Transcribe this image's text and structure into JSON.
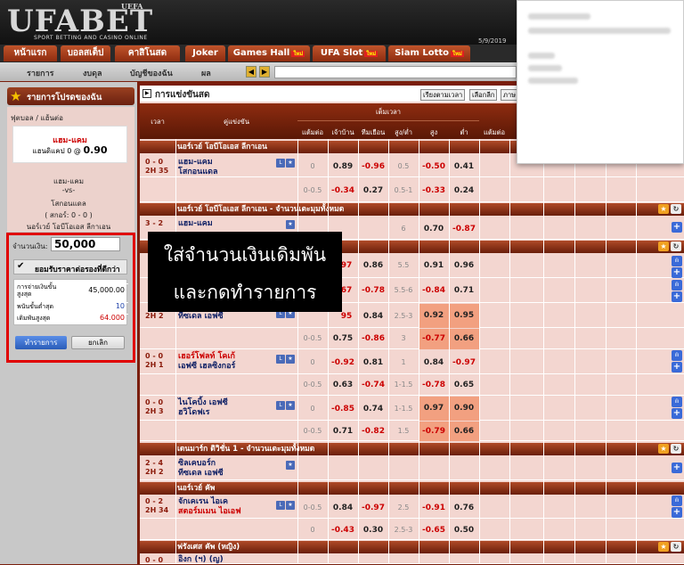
{
  "brand": {
    "logo": "UFABET",
    "uefa": "UEFA",
    "tagline": "SPORT BETTING AND CASINO ONLINE"
  },
  "nav": {
    "tabs": [
      {
        "label": "หน้าแรก"
      },
      {
        "label": "บอลสเต็ป"
      },
      {
        "label": "คาสิโนสด"
      },
      {
        "label": "Joker"
      },
      {
        "label": "Games Hall",
        "badge": "ใหม่"
      },
      {
        "label": "UFA Slot",
        "badge": "ใหม่"
      },
      {
        "label": "Siam Lotto",
        "badge": "ใหม่"
      }
    ],
    "sub": [
      "รายการ",
      "งบดุล",
      "บัญชีของฉัน",
      "ผล"
    ],
    "date": "5/9/2019"
  },
  "left": {
    "header": "รายการโปรดของฉัน",
    "sport": "ฟุตบอล / แฮ้นต่อ",
    "pick_team": "แฮม-แคม",
    "pick_line": "แฮนดิแคป 0 @",
    "pick_odds": "0.90",
    "home": "แฮม-แคม",
    "vs": "-vs-",
    "away": "โสกอนแดล",
    "score": "( สกอร์: 0 - 0 )",
    "league": "นอร์เวย์ โอบีโอเอส ลีกาเอน",
    "amount_label": "จำนวนเงิน:",
    "amount": "50,000",
    "accept_label": "ยอมรับราคาต่อรองที่ดีกว่า",
    "limits": [
      {
        "label": "การจ่ายเงินขั้นสูงสุด",
        "value": "45,000.00"
      },
      {
        "label": "พนันขั้นต่ำสุด",
        "value": "10"
      },
      {
        "label": "เดิมพันสูงสุด",
        "value": "64.000"
      }
    ],
    "submit": "ทำรายการ",
    "cancel": "ยกเลิก"
  },
  "main": {
    "title": "การแข่งขันสด",
    "sort1": "เรียงตามเวลา",
    "sort2": "เลือกลีก",
    "sort3": "ภาษ",
    "headers": {
      "time": "เวลา",
      "match": "คู่แข่งขัน",
      "fulltime": "เต็มเวลา",
      "hdp": "แต้มต่อ",
      "home": "เจ้าบ้าน",
      "away": "ทีมเยือน",
      "ou": "สูง/ต่ำ",
      "over": "สูง",
      "under": "ต่ำ",
      "extra": "แต้มต่อ"
    }
  },
  "overlay": {
    "line1": "ใส่จำนวนเงินเดิมพัน",
    "line2": "และกดทำรายการ"
  },
  "leagues": [
    {
      "name": "นอร์เวย์ โอบีโอเอส ลีกาเอน"
    },
    {
      "name": "นอร์เวย์ โอบีโอเอส ลีกาเอน - จำนวนเตะมุมทั้งหมด"
    },
    {
      "name": "เดนมาร์ก ดิวิชั่น 1 - จำนวนเตะมุมทั้งหมด"
    },
    {
      "name": "นอร์เวย์ คัพ"
    },
    {
      "name": "ฟรังเศส คัพ (หญิง)"
    }
  ],
  "matches": [
    {
      "score": "0 - 0",
      "time": "2H 35",
      "home": "แฮม-แคม",
      "away": "โสกอนแดล",
      "r1": [
        "0",
        "0.89",
        "-0.96",
        "0.5",
        "-0.50",
        "0.41"
      ],
      "r2": [
        "0-0.5",
        "-0.34",
        "0.27",
        "0.5-1",
        "-0.33",
        "0.24"
      ]
    },
    {
      "score": "3 - 2",
      "home": "แฮม-แคม",
      "r1": [
        "6",
        "0.70",
        "-0.87"
      ]
    },
    {
      "r1": [
        "97",
        "0.86",
        "5.5",
        "0.91",
        "0.96"
      ],
      "r2": [
        "67",
        "-0.78",
        "5.5-6",
        "-0.84",
        "0.71"
      ]
    },
    {
      "time": "2H 2",
      "away": "ทีซเดล เอฟซี",
      "r1": [
        "95",
        "0.84",
        "2.5-3",
        "0.92",
        "0.95"
      ],
      "r2": [
        "0-0.5",
        "0.75",
        "-0.86",
        "3",
        "-0.77",
        "0.66"
      ]
    },
    {
      "score": "0 - 0",
      "time": "2H 1",
      "home": "เฮอร์โฟลท์ โคเก้",
      "away": "เอฟซี เฮลซิงกอร์",
      "r1": [
        "0",
        "-0.92",
        "0.81",
        "1",
        "0.84",
        "-0.97"
      ],
      "r2": [
        "0-0.5",
        "0.63",
        "-0.74",
        "1-1.5",
        "-0.78",
        "0.65"
      ]
    },
    {
      "score": "0 - 0",
      "time": "2H 3",
      "home": "ไนโคบิ้ง เอฟซี",
      "away": "ฮวิโดฟเร",
      "r1": [
        "0",
        "-0.85",
        "0.74",
        "1-1.5",
        "0.97",
        "0.90"
      ],
      "r2": [
        "0-0.5",
        "0.71",
        "-0.82",
        "1.5",
        "-0.79",
        "0.66"
      ]
    },
    {
      "score": "2 - 4",
      "time": "2H 2",
      "home": "ซิลเคบอร์ก",
      "away": "ทีซเดล เอฟซี"
    },
    {
      "score": "0 - 2",
      "time": "2H 34",
      "home": "จักเคเรน ไอเค",
      "away": "สตอร์มเมน ไอเอฟ",
      "r1": [
        "0-0.5",
        "0.84",
        "-0.97",
        "2.5",
        "-0.91",
        "0.76"
      ],
      "r2": [
        "0",
        "-0.43",
        "0.30",
        "2.5-3",
        "-0.65",
        "0.50"
      ]
    },
    {
      "score": "0 - 0",
      "home": "อิงก (ฯ) (ญ)"
    }
  ],
  "icons": {
    "star": "star-icon",
    "plus": "plus-icon",
    "stats": "stats-icon",
    "tv": "tv-icon"
  },
  "colors": {
    "header": "#8e2c10",
    "highlight": "#f2a080",
    "negative": "#cc0000",
    "frame": "#e00000"
  }
}
